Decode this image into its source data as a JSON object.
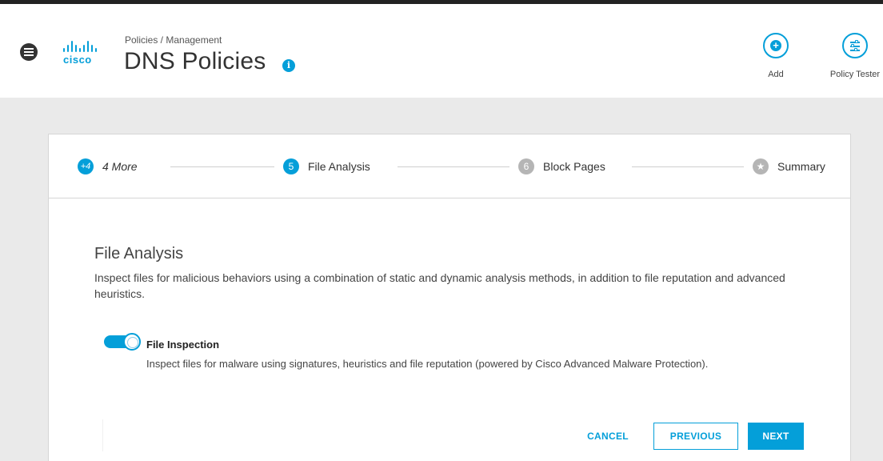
{
  "header": {
    "breadcrumb": "Policies / Management",
    "title": "DNS Policies",
    "info_icon": "i",
    "logo_text": "cisco",
    "add_label": "Add",
    "add_icon": "+",
    "tester_label": "Policy Tester"
  },
  "steps": [
    {
      "badge": "+4",
      "label": "4 More",
      "state": "more"
    },
    {
      "badge": "5",
      "label": "File Analysis",
      "state": "active"
    },
    {
      "badge": "6",
      "label": "Block Pages",
      "state": "inactive"
    },
    {
      "badge": "★",
      "label": "Summary",
      "state": "inactive"
    }
  ],
  "section": {
    "title": "File Analysis",
    "description": "Inspect files for malicious behaviors using a combination of static and dynamic analysis methods, in addition to file reputation and advanced heuristics."
  },
  "file_inspection": {
    "enabled": true,
    "title": "File Inspection",
    "description": "Inspect files for malware using signatures, heuristics and file reputation (powered by Cisco Advanced Malware Protection)."
  },
  "buttons": {
    "cancel": "CANCEL",
    "previous": "PREVIOUS",
    "next": "NEXT"
  },
  "colors": {
    "accent": "#049fd9",
    "inactive": "#b5b5b5"
  }
}
